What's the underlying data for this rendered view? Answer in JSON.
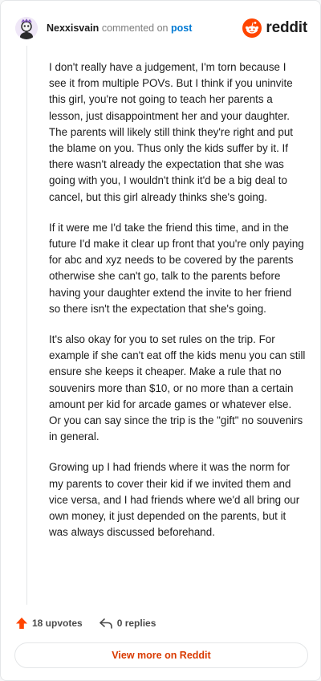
{
  "header": {
    "username": "Nexxisvain",
    "action_text": "commented on",
    "post_link": "post",
    "brand_word": "reddit"
  },
  "comment": {
    "paragraphs": [
      "I don't really have a judgement, I'm torn because I see it from multiple POVs. But I think if you uninvite this girl, you're not going to teach her parents a lesson, just disappointment her and your daughter. The parents will likely still think they're right and put the blame on you. Thus only the kids suffer by it. If there wasn't already the expectation that she was going with you, I wouldn't think it'd be a big deal to cancel, but this girl already thinks she's going.",
      "If it were me I'd take the friend this time, and in the future I'd make it clear up front that you're only paying for abc and xyz needs to be covered by the parents otherwise she can't go, talk to the parents before having your daughter extend the invite to her friend so there isn't the expectation that she's going.",
      "It's also okay for you to set rules on the trip. For example if she can't eat off the kids menu you can still ensure she keeps it cheaper. Make a rule that no souvenirs more than $10, or no more than a certain amount per kid for arcade games or whatever else. Or you can say since the trip is the \"gift\" no souvenirs in general.",
      "Growing up I had friends where it was the norm for my parents to cover their kid if we invited them and vice versa, and I had friends where we'd all bring our own money, it just depended on the parents, but it was always discussed beforehand."
    ]
  },
  "footer": {
    "upvotes": "18 upvotes",
    "replies": "0 replies",
    "view_more": "View more on Reddit"
  },
  "colors": {
    "brand": "#ff4500",
    "link": "#0079d3",
    "view_more": "#d93a00"
  },
  "icons": [
    "avatar",
    "reddit-logo-icon",
    "upvote-arrow-icon",
    "reply-arrow-icon"
  ]
}
